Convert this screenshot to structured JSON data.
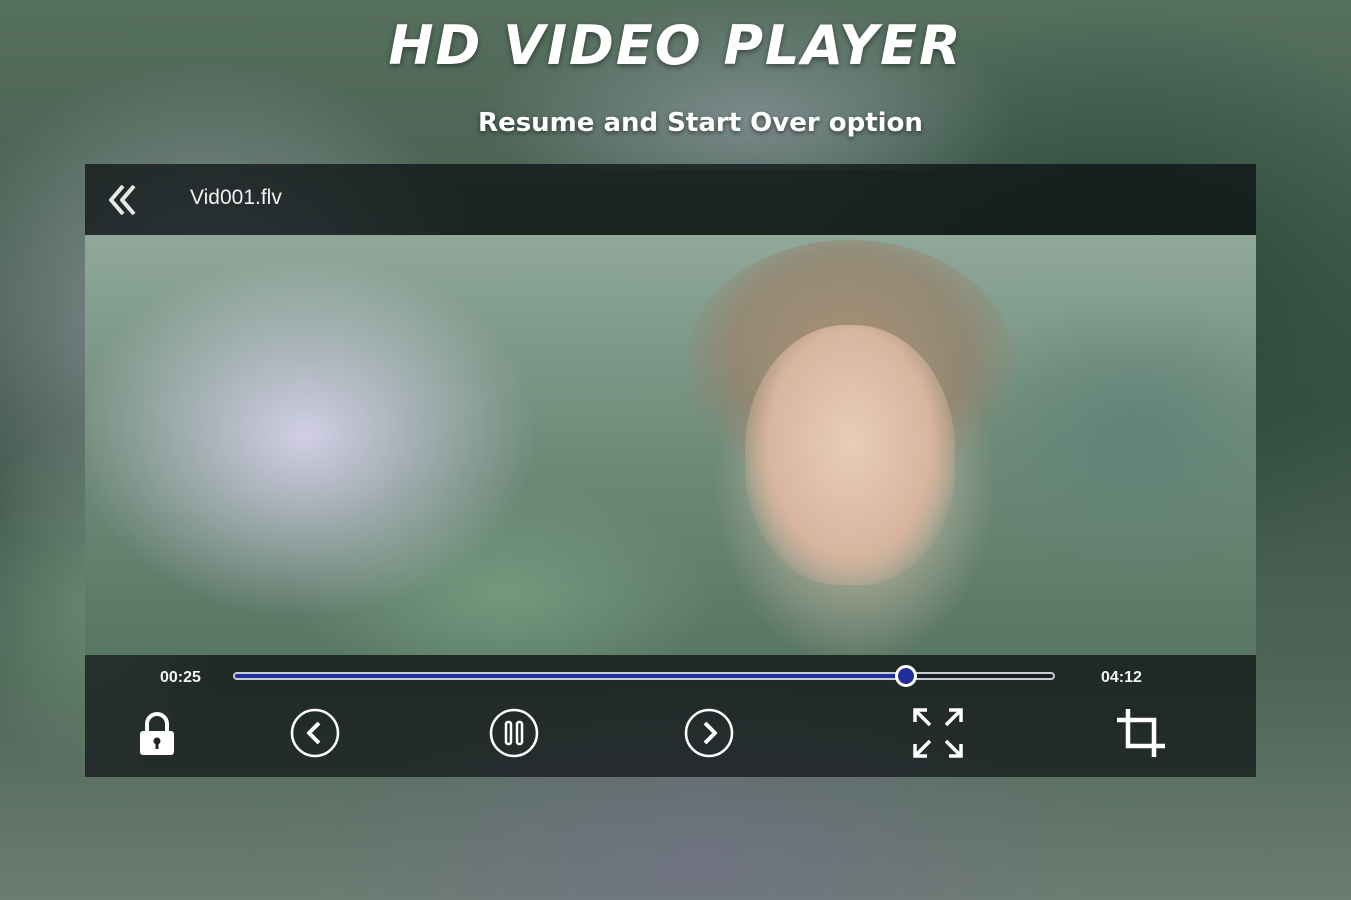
{
  "promo": {
    "headline": "HD VIDEO PLAYER",
    "subheadline": "Resume and Start Over option"
  },
  "player": {
    "file_name": "Vid001.flv",
    "current_time": "00:25",
    "total_time": "04:12",
    "progress": 0.82,
    "accent_color": "#1f2f9c",
    "icons": {
      "back": "double-chevron-left-icon",
      "lock": "lock-icon",
      "previous": "previous-icon",
      "pause": "pause-icon",
      "next": "next-icon",
      "fullscreen": "fullscreen-icon",
      "crop": "crop-icon"
    }
  }
}
